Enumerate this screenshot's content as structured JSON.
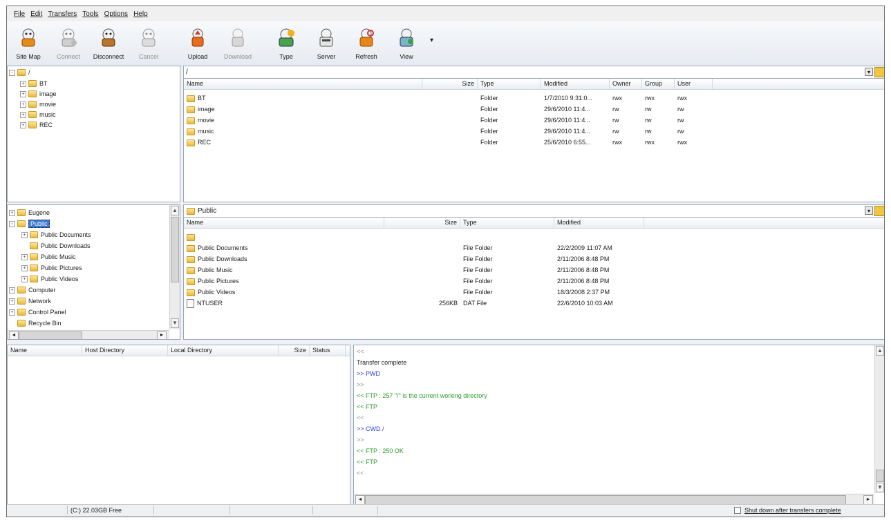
{
  "menu": [
    "File",
    "Edit",
    "Transfers",
    "Tools",
    "Options",
    "Help"
  ],
  "toolbar": {
    "buttons": [
      {
        "label": "Site Map",
        "icon": "site-map-icon",
        "enabled": true
      },
      {
        "label": "Connect",
        "icon": "connect-icon",
        "enabled": false
      },
      {
        "label": "Disconnect",
        "icon": "disconnect-icon",
        "enabled": true
      },
      {
        "label": "Cancel",
        "icon": "cancel-icon",
        "enabled": false
      },
      {
        "label": "Upload",
        "icon": "upload-icon",
        "enabled": true
      },
      {
        "label": "Download",
        "icon": "download-icon",
        "enabled": false
      },
      {
        "label": "Type",
        "icon": "type-icon",
        "enabled": true
      },
      {
        "label": "Server",
        "icon": "server-icon",
        "enabled": true
      },
      {
        "label": "Refresh",
        "icon": "refresh-icon",
        "enabled": true
      },
      {
        "label": "View",
        "icon": "view-icon",
        "enabled": true
      }
    ],
    "more": "▾"
  },
  "remote_tree": {
    "root": "/",
    "items": [
      "BT",
      "image",
      "movie",
      "music",
      "REC"
    ]
  },
  "remote_list": {
    "path": "/",
    "headers": {
      "name": "Name",
      "size": "Size",
      "type": "Type",
      "modified": "Modified",
      "owner": "Owner",
      "group": "Group",
      "user": "User"
    },
    "rows": [
      {
        "name": "BT",
        "size": "",
        "type": "Folder",
        "modified": "1/7/2010 9:31:0...",
        "owner": "rwx",
        "group": "rwx",
        "user": "rwx"
      },
      {
        "name": "image",
        "size": "",
        "type": "Folder",
        "modified": "29/6/2010 11:4...",
        "owner": "rw",
        "group": "rw",
        "user": "rw"
      },
      {
        "name": "movie",
        "size": "",
        "type": "Folder",
        "modified": "29/6/2010 11:4...",
        "owner": "rw",
        "group": "rw",
        "user": "rw"
      },
      {
        "name": "music",
        "size": "",
        "type": "Folder",
        "modified": "29/6/2010 11:4...",
        "owner": "rw",
        "group": "rw",
        "user": "rw"
      },
      {
        "name": "REC",
        "size": "",
        "type": "Folder",
        "modified": "25/6/2010 6:55...",
        "owner": "rwx",
        "group": "rwx",
        "user": "rwx"
      }
    ]
  },
  "local_tree": {
    "items": [
      {
        "label": "Eugene",
        "indent": 0,
        "expander": "+",
        "selected": false
      },
      {
        "label": "Public",
        "indent": 0,
        "expander": "-",
        "selected": true
      },
      {
        "label": "Public Documents",
        "indent": 1,
        "expander": "+",
        "selected": false
      },
      {
        "label": "Public Downloads",
        "indent": 1,
        "expander": "",
        "selected": false
      },
      {
        "label": "Public Music",
        "indent": 1,
        "expander": "+",
        "selected": false
      },
      {
        "label": "Public Pictures",
        "indent": 1,
        "expander": "+",
        "selected": false
      },
      {
        "label": "Public Videos",
        "indent": 1,
        "expander": "+",
        "selected": false
      },
      {
        "label": "Computer",
        "indent": 0,
        "expander": "+",
        "selected": false
      },
      {
        "label": "Network",
        "indent": 0,
        "expander": "+",
        "selected": false
      },
      {
        "label": "Control Panel",
        "indent": 0,
        "expander": "+",
        "selected": false
      },
      {
        "label": "Recycle Bin",
        "indent": 0,
        "expander": "",
        "selected": false
      }
    ]
  },
  "local_list": {
    "path": "Public",
    "headers": {
      "name": "Name",
      "size": "Size",
      "type": "Type",
      "modified": "Modified"
    },
    "rows": [
      {
        "name": "",
        "size": "",
        "type": "",
        "modified": ""
      },
      {
        "name": "Public Documents",
        "size": "",
        "type": "File Folder",
        "modified": "22/2/2009 11:07 AM"
      },
      {
        "name": "Public Downloads",
        "size": "",
        "type": "File Folder",
        "modified": "2/11/2006 8:48 PM"
      },
      {
        "name": "Public Music",
        "size": "",
        "type": "File Folder",
        "modified": "2/11/2006 8:48 PM"
      },
      {
        "name": "Public Pictures",
        "size": "",
        "type": "File Folder",
        "modified": "2/11/2006 8:48 PM"
      },
      {
        "name": "Public Videos",
        "size": "",
        "type": "File Folder",
        "modified": "18/3/2008 2:37 PM"
      },
      {
        "name": "NTUSER",
        "size": "256KB",
        "type": "DAT File",
        "modified": "22/6/2010 10:03 AM"
      }
    ]
  },
  "queue": {
    "headers": {
      "name": "Name",
      "host": "Host Directory",
      "local": "Local Directory",
      "size": "Size",
      "status": "Status"
    }
  },
  "log": [
    {
      "text": "<<",
      "color": "grey"
    },
    {
      "text": "Transfer complete",
      "color": "black"
    },
    {
      "text": ">> PWD",
      "color": "blue"
    },
    {
      "text": ">>",
      "color": "grey"
    },
    {
      "text": "<< FTP : 257 \"/\" is the current working directory",
      "color": "green"
    },
    {
      "text": "<< FTP",
      "color": "green"
    },
    {
      "text": "<<",
      "color": "grey"
    },
    {
      "text": ">> CWD /",
      "color": "blue"
    },
    {
      "text": ">>",
      "color": "grey"
    },
    {
      "text": "<< FTP : 250 OK",
      "color": "green"
    },
    {
      "text": "<< FTP",
      "color": "green"
    },
    {
      "text": "<<",
      "color": "grey"
    }
  ],
  "status": {
    "drive": "(C:) 22.03GB Free",
    "shutdown_label": "Shut down after transfers complete"
  },
  "colors": {
    "accent": "#2a3bd6",
    "log_green": "#2b9a2b",
    "selected": "#3a78d6"
  }
}
